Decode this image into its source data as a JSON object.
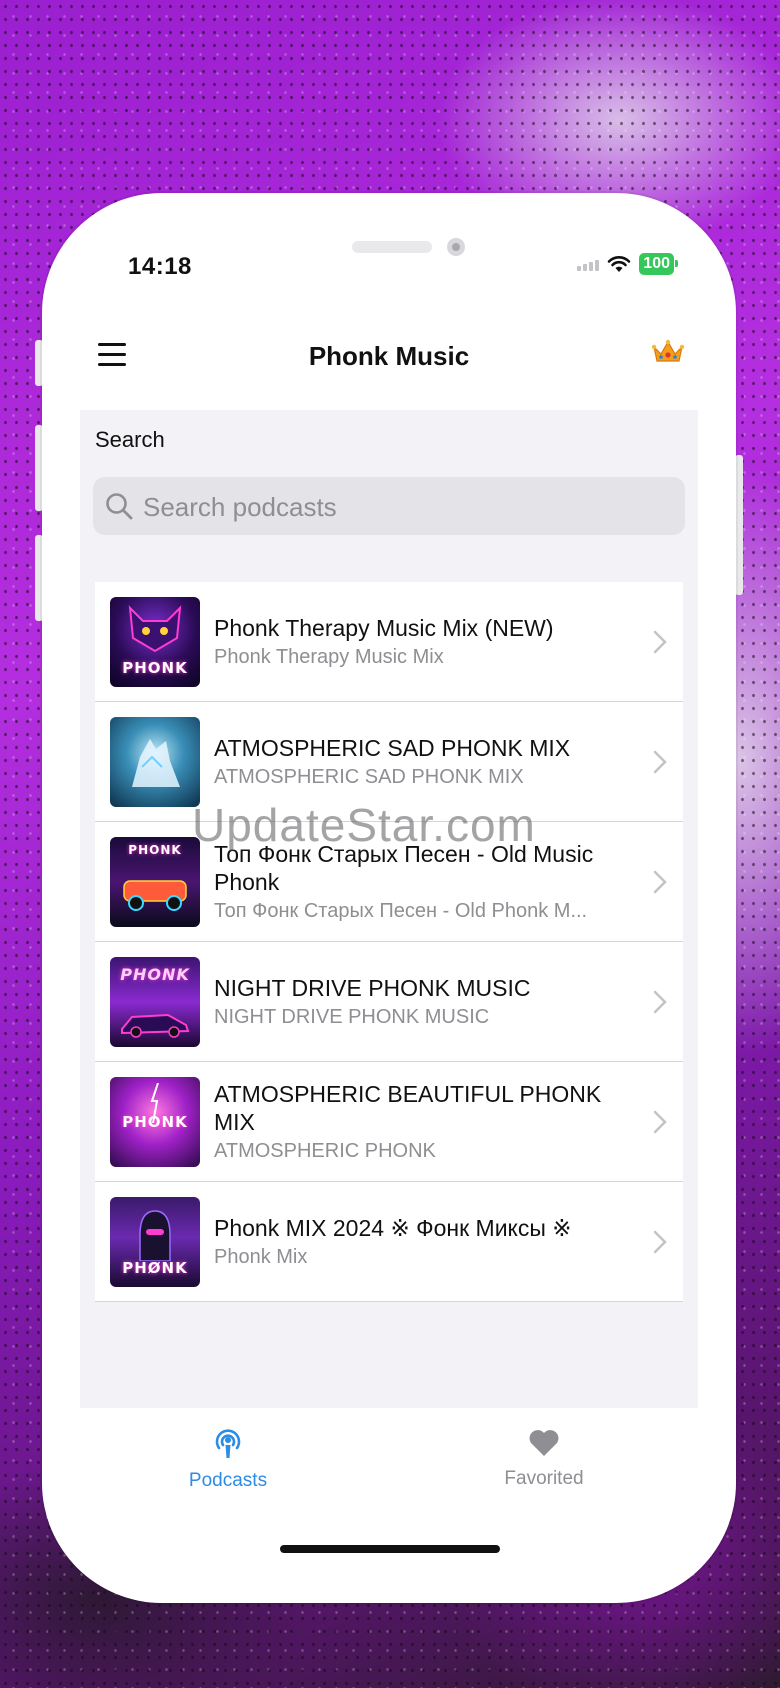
{
  "status_bar": {
    "time": "14:18",
    "battery": "100"
  },
  "nav": {
    "title": "Phonk Music"
  },
  "search": {
    "heading": "Search",
    "placeholder": "Search podcasts"
  },
  "podcasts": [
    {
      "title": "Phonk Therapy Music Mix  (NEW)",
      "subtitle": "Phonk Therapy Music Mix",
      "art_text": "PHONK"
    },
    {
      "title": "ATMOSPHERIC SAD PHONK MIX",
      "subtitle": "ATMOSPHERIC SAD PHONK MIX",
      "art_text": ""
    },
    {
      "title": "Топ Фонк Старых Песен - Old Music Phonk",
      "subtitle": "Топ Фонк Старых Песен - Old Phonk M...",
      "art_text": "PHONK"
    },
    {
      "title": "NIGHT DRIVE PHONK MUSIC",
      "subtitle": "NIGHT DRIVE PHONK MUSIC",
      "art_text": "PHONK"
    },
    {
      "title": "ATMOSPHERIC BEAUTIFUL PHONK MIX",
      "subtitle": "ATMOSPHERIC  PHONK",
      "art_text": "PHONK"
    },
    {
      "title": "Phonk MIX 2024 ※ Фонк Миксы ※",
      "subtitle": "Phonk Mix",
      "art_text": "PHØNK"
    }
  ],
  "watermark": "UpdateStar.com",
  "tabs": {
    "podcasts": "Podcasts",
    "favorited": "Favorited"
  },
  "colors": {
    "accent": "#2d8ce6",
    "inactive": "#8e8e93",
    "crown": "#f2a01c"
  }
}
